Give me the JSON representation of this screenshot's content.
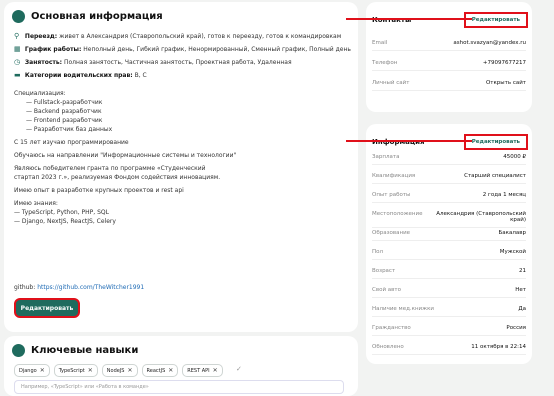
{
  "main": {
    "title": "Основная информация",
    "relocation_label": "Переезд:",
    "relocation_value": "живет в Александрия (Ставропольский край), готов к переезду, готов к командировкам",
    "schedule_label": "График работы:",
    "schedule_value": "Неполный день, Гибкий график, Ненормированный, Сменный график, Полный день",
    "employment_label": "Занятость:",
    "employment_value": "Полная занятость, Частичная занятость, Проектная работа, Удаленная",
    "license_label": "Категории водительских прав:",
    "license_value": "B, C",
    "desc_lines": [
      "Специализация:",
      "— Fullstack-разработчик",
      "— Backend разработчик",
      "— Frontend разработчик",
      "— Разработчик баз данных",
      "",
      "С 15 лет изучаю программирование",
      "",
      "Обучаюсь на направлении \"Информационные системы и технологии\"",
      "",
      "Являюсь победителем гранта по программе «Студенческий",
      "стартап 2023 г.», реализуемая Фондом содействия инновациям.",
      "",
      "Имею опыт в разработке крупных проектов и rest api",
      "",
      "Имею знания:",
      "— TypeScript, Python, PHP, SQL",
      "— Django, NextJS, ReactJS, Celery"
    ],
    "github_label": "github:",
    "github_url": "https://github.com/TheWitcher1991",
    "edit_label": "Редактировать"
  },
  "skills": {
    "title": "Ключевые навыки",
    "chips": [
      "Django",
      "TypeScript",
      "NodeJS",
      "ReactJS",
      "REST API"
    ],
    "input_placeholder": "Например, «TypeScript» или «Работа в команде»"
  },
  "contacts": {
    "title": "Контакты",
    "edit_label": "Редактировать",
    "rows": [
      {
        "k": "Email",
        "v": "ashot.svazyan@yandex.ru"
      },
      {
        "k": "Телефон",
        "v": "+79097677217"
      },
      {
        "k": "Личный сайт",
        "v": "Открыть сайт"
      }
    ]
  },
  "info": {
    "title": "Информация",
    "edit_label": "Редактировать",
    "rows": [
      {
        "k": "Зарплата",
        "v": "45000 ₽"
      },
      {
        "k": "Квалификация",
        "v": "Старший специалист"
      },
      {
        "k": "Опыт работы",
        "v": "2 года 1 месяц"
      },
      {
        "k": "Местоположение",
        "v": "Александрия (Ставропольский край)"
      },
      {
        "k": "Образование",
        "v": "Бакалавр"
      },
      {
        "k": "Пол",
        "v": "Мужской"
      },
      {
        "k": "Возраст",
        "v": "21"
      },
      {
        "k": "Свой авто",
        "v": "Нет"
      },
      {
        "k": "Наличие мед.книжки",
        "v": "Да"
      },
      {
        "k": "Гражданство",
        "v": "Россия"
      },
      {
        "k": "Обновлено",
        "v": "11 октября в 22:14"
      }
    ]
  },
  "colors": {
    "accent": "#1f6b5e",
    "annotation": "#e0101a"
  }
}
